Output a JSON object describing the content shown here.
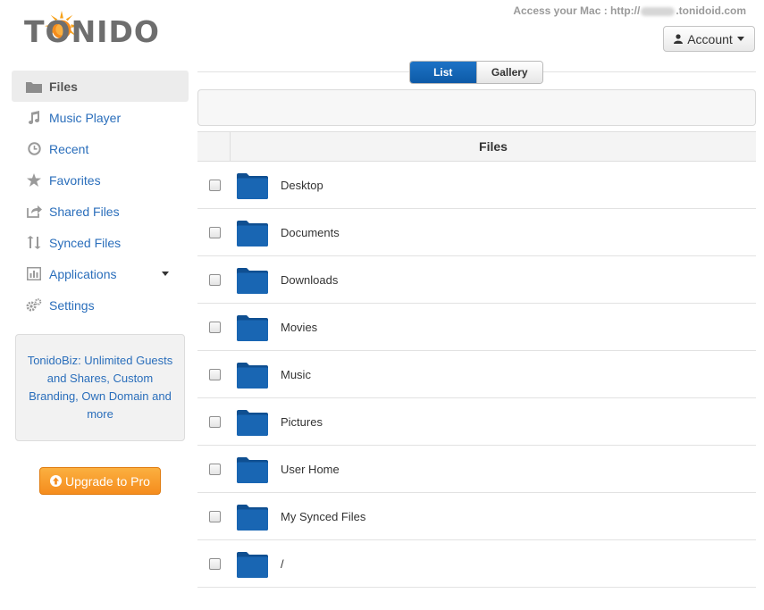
{
  "header": {
    "logo_text": "TONIDO",
    "access_prefix": "Access your Mac : http://",
    "access_suffix": ".tonidoid.com",
    "account_label": "Account"
  },
  "sidebar": {
    "items": [
      {
        "label": "Files",
        "icon": "folder-icon",
        "active": true
      },
      {
        "label": "Music Player",
        "icon": "music-note-icon"
      },
      {
        "label": "Recent",
        "icon": "clock-icon"
      },
      {
        "label": "Favorites",
        "icon": "star-icon"
      },
      {
        "label": "Shared Files",
        "icon": "share-icon"
      },
      {
        "label": "Synced Files",
        "icon": "sync-icon"
      },
      {
        "label": "Applications",
        "icon": "bar-chart-icon",
        "dropdown": true
      },
      {
        "label": "Settings",
        "icon": "gears-icon"
      }
    ],
    "promo_text": "TonidoBiz: Unlimited Guests and Shares, Custom Branding, Own Domain and more",
    "upgrade_label": "Upgrade to Pro"
  },
  "view_toggle": {
    "list_label": "List",
    "gallery_label": "Gallery"
  },
  "table": {
    "header": "Files",
    "rows": [
      "Desktop",
      "Documents",
      "Downloads",
      "Movies",
      "Music",
      "Pictures",
      "User Home",
      "My Synced Files",
      "/"
    ]
  },
  "colors": {
    "link": "#2a6ebb",
    "folder": "#1560a8",
    "upgrade": "#f5961f",
    "toggle_active": "#0d5aa7"
  }
}
